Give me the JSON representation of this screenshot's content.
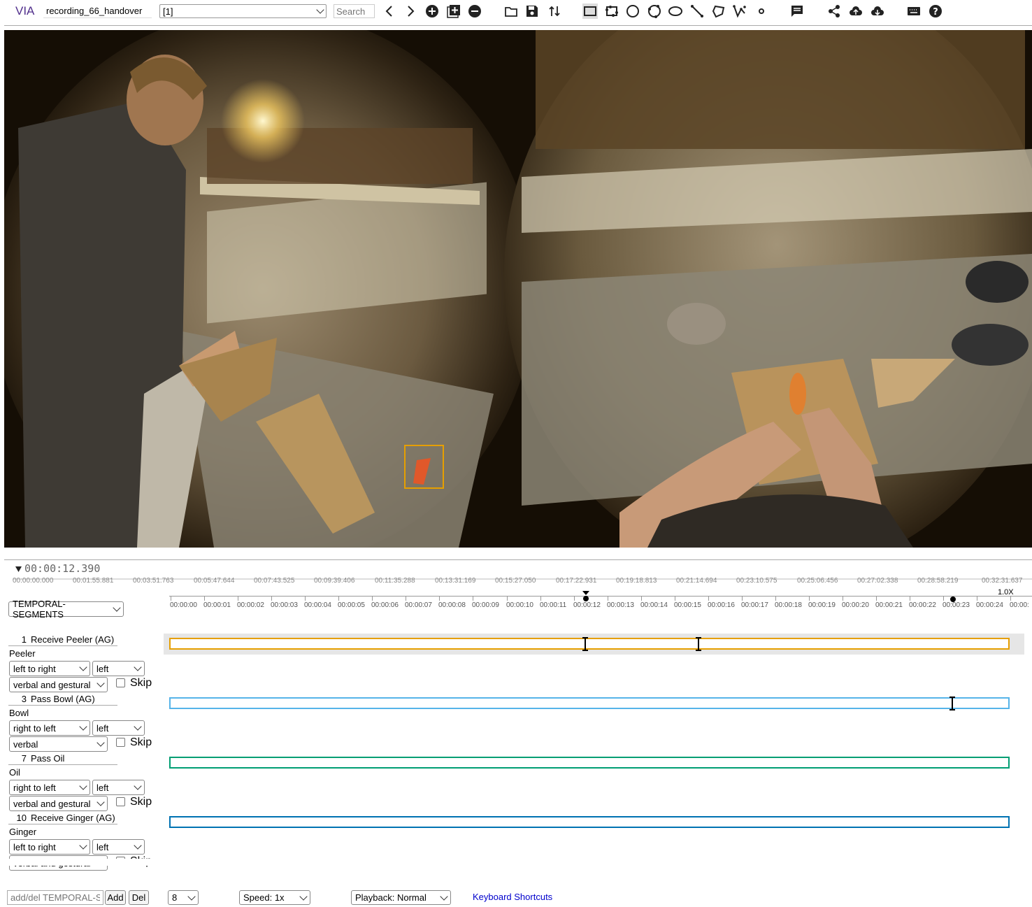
{
  "app": {
    "brand": "VIA",
    "project_name": "recording_66_handover"
  },
  "toolbar": {
    "file_selector": "[1]",
    "search_placeholder": "Search",
    "icons": [
      "prev-icon",
      "next-icon",
      "add-file-icon",
      "add-multiple-icon",
      "remove-file-icon",
      "open-folder-icon",
      "save-icon",
      "sort-icon",
      "rect-tool-icon",
      "extreme-rect-tool-icon",
      "circle-tool-icon",
      "extreme-circle-tool-icon",
      "ellipse-tool-icon",
      "line-tool-icon",
      "polygon-tool-icon",
      "polyline-tool-icon",
      "point-tool-icon",
      "comment-icon",
      "share-icon",
      "upload-icon",
      "download-icon",
      "keyboard-icon",
      "help-icon"
    ]
  },
  "timeline": {
    "current_time": "00:00:12.390",
    "global_ticks": [
      "00:00:00.000",
      "00:01:55.881",
      "00:03:51.763",
      "00:05:47.644",
      "00:07:43.525",
      "00:09:39.406",
      "00:11:35.288",
      "00:13:31.169",
      "00:15:27.050",
      "00:17:22.931",
      "00:19:18.813",
      "00:21:14.694",
      "00:23:10.575",
      "00:25:06.456",
      "00:27:02.338",
      "00:28:58.219",
      "00:32:31.637"
    ],
    "zoom_label": "1.0X",
    "local_ticks": [
      "00:00:00",
      "00:00:01",
      "00:00:02",
      "00:00:03",
      "00:00:04",
      "00:00:05",
      "00:00:06",
      "00:00:07",
      "00:00:08",
      "00:00:09",
      "00:00:10",
      "00:00:11",
      "00:00:12",
      "00:00:13",
      "00:00:14",
      "00:00:15",
      "00:00:16",
      "00:00:17",
      "00:00:18",
      "00:00:19",
      "00:00:20",
      "00:00:21",
      "00:00:22",
      "00:00:23",
      "00:00:24",
      "00:00:"
    ],
    "attribute_selector": "TEMPORAL-SEGMENTS"
  },
  "segments": [
    {
      "index": "1",
      "name": "Receive Peeler (AG)",
      "object": "Peeler",
      "direction": "left to right",
      "hand": "left",
      "mode": "verbal and gestural",
      "skip": "Skip",
      "color": "#e69f00"
    },
    {
      "index": "3",
      "name": "Pass Bowl (AG)",
      "object": "Bowl",
      "direction": "right to left",
      "hand": "left",
      "mode": "verbal",
      "skip": "Skip",
      "color": "#56b4e9"
    },
    {
      "index": "7",
      "name": "Pass Oil",
      "object": "Oil",
      "direction": "right to left",
      "hand": "left",
      "mode": "verbal and gestural",
      "skip": "Skip",
      "color": "#009e73"
    },
    {
      "index": "10",
      "name": "Receive Ginger (AG)",
      "object": "Ginger",
      "direction": "left to right",
      "hand": "left",
      "mode": "verbal and gestural",
      "skip": "Skip",
      "color": "#0072b2"
    }
  ],
  "footer": {
    "segment_input_placeholder": "add/del TEMPORAL-SEGMENTS",
    "add_label": "Add",
    "del_label": "Del",
    "fps_value": "8",
    "speed_value": "Speed: 1x",
    "playback_value": "Playback: Normal",
    "shortcuts_link": "Keyboard Shortcuts"
  },
  "colors": {
    "accent": "#512f8c",
    "link": "#0000cc",
    "selection_box": "#e69f00"
  }
}
